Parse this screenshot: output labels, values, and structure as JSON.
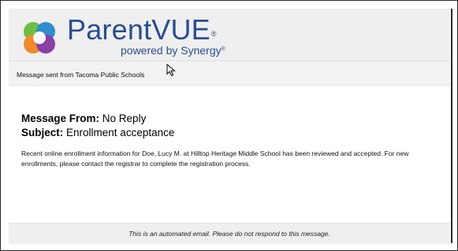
{
  "header": {
    "logo_icon": "parentvue-logo-icon",
    "brand_name": "ParentVUE",
    "brand_reg": "®",
    "tagline": "powered by Synergy",
    "tagline_reg": "®",
    "brand_color": "#2a4d8f"
  },
  "sent_bar": {
    "text": "Message sent from Tacoma Public Schools"
  },
  "message": {
    "from_label": "Message From:",
    "from_value": "No Reply",
    "subject_label": "Subject:",
    "subject_value": "Enrollment acceptance",
    "body": "Recent online enrollment information for Doe, Lucy M. at Hilltop Heritage Middle School has been reviewed and accepted.  For new enrollments, please contact the registrar to complete the registration process."
  },
  "footer": {
    "text": "This is an automated email. Please do not respond to this message."
  }
}
